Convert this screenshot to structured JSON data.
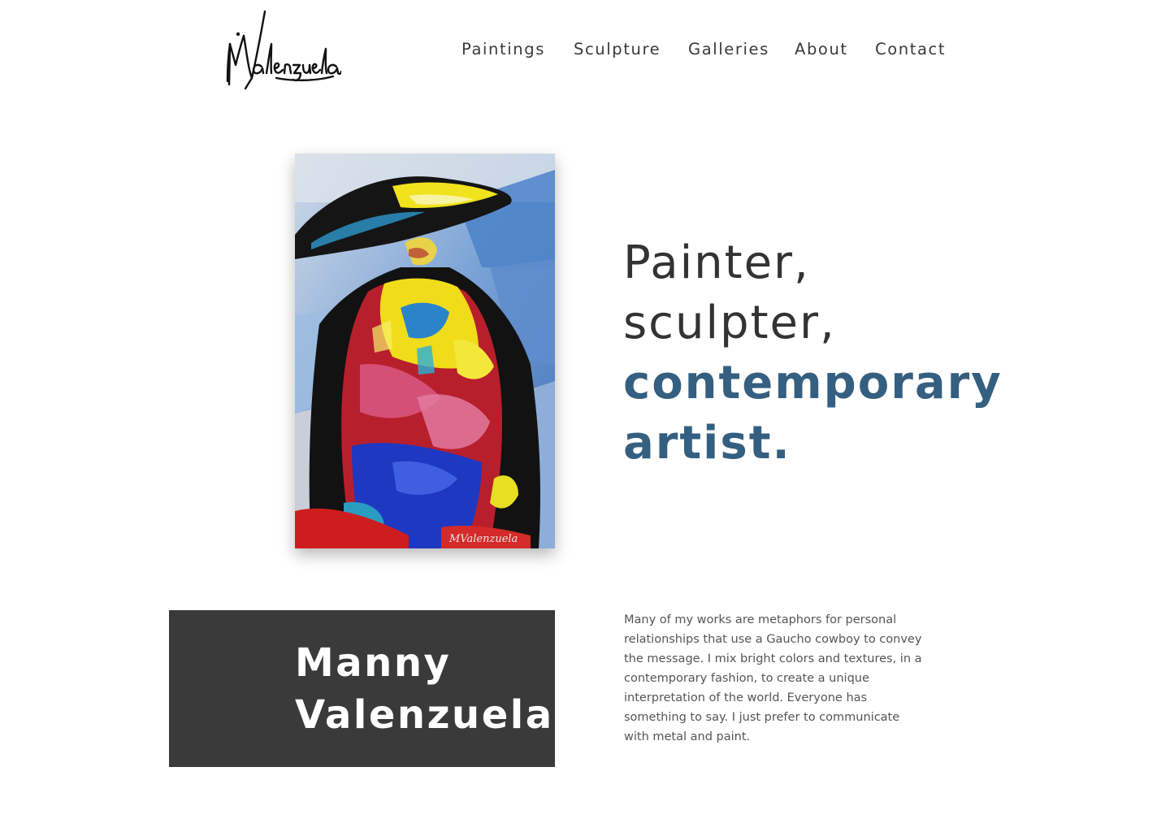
{
  "header": {
    "logo_text": "MValenzuela",
    "nav": [
      {
        "label": "Paintings"
      },
      {
        "label": "Sculpture"
      },
      {
        "label": "Galleries"
      },
      {
        "label": "About"
      },
      {
        "label": "Contact"
      }
    ]
  },
  "hero": {
    "painting_signature": "MValenzuela",
    "headline": {
      "line1": "Painter,",
      "line2": "sculpter,",
      "line3": "contemporary",
      "line4": "artist."
    }
  },
  "intro": {
    "name_line1": "Manny",
    "name_line2": "Valenzuela",
    "bio": "Many of my works are metaphors for personal relationships that use a Gaucho cowboy to convey the message. I mix bright colors and textures, in a contemporary fashion, to create a unique interpretation of the world. Everyone has something to say. I just prefer to communicate with metal and paint."
  },
  "colors": {
    "accent": "#355f80",
    "text_dark": "#333333",
    "name_block_bg": "#3a3a3a",
    "body_text": "#555555"
  },
  "icons": {
    "logo": "signature-logo"
  }
}
